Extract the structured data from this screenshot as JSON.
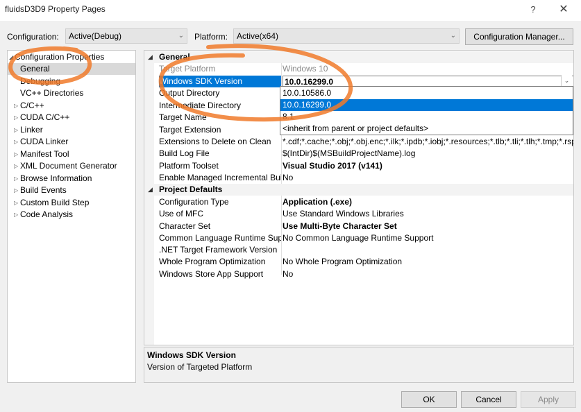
{
  "window": {
    "title": "fluidsD3D9 Property Pages",
    "help_glyph": "?",
    "close_glyph": "✕"
  },
  "config": {
    "configuration_label": "Configuration:",
    "configuration_value": "Active(Debug)",
    "platform_label": "Platform:",
    "platform_value": "Active(x64)",
    "manager_button": "Configuration Manager..."
  },
  "tree": {
    "items": [
      {
        "label": "Configuration Properties",
        "expander": "◢"
      },
      {
        "label": "General"
      },
      {
        "label": "Debugging"
      },
      {
        "label": "VC++ Directories"
      },
      {
        "label": "C/C++",
        "expander": "▷"
      },
      {
        "label": "CUDA C/C++",
        "expander": "▷"
      },
      {
        "label": "Linker",
        "expander": "▷"
      },
      {
        "label": "CUDA Linker",
        "expander": "▷"
      },
      {
        "label": "Manifest Tool",
        "expander": "▷"
      },
      {
        "label": "XML Document Generator",
        "expander": "▷"
      },
      {
        "label": "Browse Information",
        "expander": "▷"
      },
      {
        "label": "Build Events",
        "expander": "▷"
      },
      {
        "label": "Custom Build Step",
        "expander": "▷"
      },
      {
        "label": "Code Analysis",
        "expander": "▷"
      }
    ]
  },
  "grid": {
    "sections": [
      {
        "title": "General",
        "chevron": "◢"
      },
      {
        "title": "Project Defaults",
        "chevron": "◢"
      }
    ],
    "general_rows": [
      {
        "name": "Target Platform",
        "value": "Windows 10"
      },
      {
        "name": "Windows SDK Version",
        "value": "10.0.16299.0"
      },
      {
        "name": "Output Directory",
        "value": ""
      },
      {
        "name": "Intermediate Directory",
        "value": ""
      },
      {
        "name": "Target Name",
        "value": ""
      },
      {
        "name": "Target Extension",
        "value": ""
      },
      {
        "name": "Extensions to Delete on Clean",
        "value": "*.cdf;*.cache;*.obj;*.obj.enc;*.ilk;*.ipdb;*.iobj;*.resources;*.tlb;*.tli;*.tlh;*.tmp;*.rsp"
      },
      {
        "name": "Build Log File",
        "value": "$(IntDir)$(MSBuildProjectName).log"
      },
      {
        "name": "Platform Toolset",
        "value": "Visual Studio 2017 (v141)"
      },
      {
        "name": "Enable Managed Incremental Build",
        "value": "No"
      }
    ],
    "defaults_rows": [
      {
        "name": "Configuration Type",
        "value": "Application (.exe)"
      },
      {
        "name": "Use of MFC",
        "value": "Use Standard Windows Libraries"
      },
      {
        "name": "Character Set",
        "value": "Use Multi-Byte Character Set"
      },
      {
        "name": "Common Language Runtime Support",
        "value": "No Common Language Runtime Support"
      },
      {
        "name": ".NET Target Framework Version",
        "value": ""
      },
      {
        "name": "Whole Program Optimization",
        "value": "No Whole Program Optimization"
      },
      {
        "name": "Windows Store App Support",
        "value": "No"
      }
    ]
  },
  "dropdown": {
    "options": [
      "10.0.10586.0",
      "10.0.16299.0",
      "8.1",
      "<inherit from parent or project defaults>"
    ],
    "selected": "10.0.16299.0"
  },
  "description": {
    "title": "Windows SDK Version",
    "text": "Version of Targeted Platform"
  },
  "buttons": {
    "ok": "OK",
    "cancel": "Cancel",
    "apply": "Apply"
  },
  "colors": {
    "selection": "#0078d7",
    "annotation": "#f07a2a"
  }
}
